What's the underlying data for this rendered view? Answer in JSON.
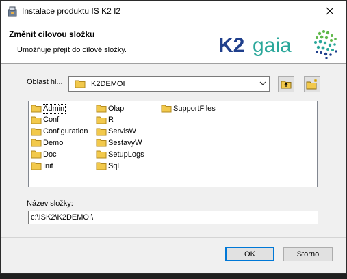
{
  "window": {
    "title": "Instalace produktu IS K2 I2"
  },
  "header": {
    "title": "Změnit cílovou složku",
    "subtitle": "Umožňuje přejít do cílové složky.",
    "logo_text": "K2 gaia"
  },
  "location": {
    "label": "Oblast hl...",
    "selected": "K2DEMOI"
  },
  "folders": [
    {
      "name": "Admin"
    },
    {
      "name": "Conf"
    },
    {
      "name": "Configuration"
    },
    {
      "name": "Demo"
    },
    {
      "name": "Doc"
    },
    {
      "name": "Init"
    },
    {
      "name": "Olap"
    },
    {
      "name": "R"
    },
    {
      "name": "ServisW"
    },
    {
      "name": "SestavyW"
    },
    {
      "name": "SetupLogs"
    },
    {
      "name": "Sql"
    },
    {
      "name": "SupportFiles"
    }
  ],
  "folder_name": {
    "label": "Název složky:",
    "value": "c:\\ISK2\\K2DEMOI\\"
  },
  "buttons": {
    "ok": "OK",
    "cancel": "Storno"
  },
  "icons": {
    "app": "installer-icon",
    "up": "folder-up-icon",
    "new": "new-folder-icon",
    "close": "close-icon"
  },
  "colors": {
    "accent": "#0078d7",
    "folder": "#f2c94c"
  }
}
